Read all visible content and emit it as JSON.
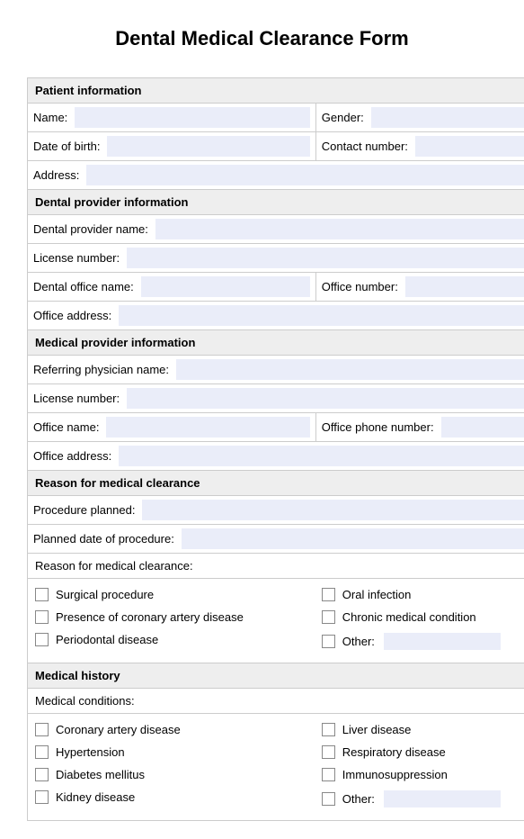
{
  "title": "Dental Medical Clearance Form",
  "sections": {
    "patient": {
      "header": "Patient information",
      "name": "Name:",
      "gender": "Gender:",
      "dob": "Date of birth:",
      "contact": "Contact number:",
      "address": "Address:"
    },
    "dental": {
      "header": "Dental provider information",
      "provider_name": "Dental provider name:",
      "license": "License number:",
      "office_name": "Dental office name:",
      "office_number": "Office number:",
      "office_address": "Office address:"
    },
    "medical": {
      "header": "Medical provider information",
      "physician": "Referring physician name:",
      "license": "License number:",
      "office_name": "Office name:",
      "office_phone": "Office phone number:",
      "office_address": "Office address:"
    },
    "reason": {
      "header": "Reason for medical clearance",
      "procedure": "Procedure planned:",
      "date": "Planned date of procedure:",
      "reason_label": "Reason for medical clearance:",
      "options_left": [
        "Surgical procedure",
        "Presence of coronary artery disease",
        "Periodontal disease"
      ],
      "options_right": [
        "Oral infection",
        "Chronic medical condition"
      ],
      "other": "Other:"
    },
    "history": {
      "header": "Medical history",
      "conditions_label": "Medical conditions:",
      "options_left": [
        "Coronary artery disease",
        "Hypertension",
        "Diabetes mellitus",
        "Kidney disease"
      ],
      "options_right": [
        "Liver disease",
        "Respiratory disease",
        "Immunosuppression"
      ],
      "other": "Other:"
    }
  }
}
